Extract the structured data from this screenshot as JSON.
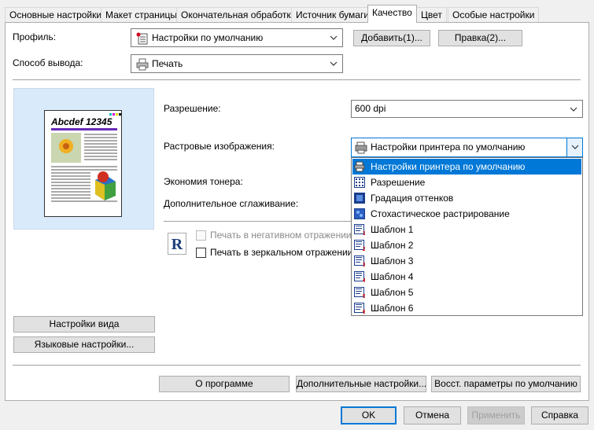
{
  "tabs": [
    "Основные настройки",
    "Макет страницы",
    "Окончательная обработка",
    "Источник бумаги",
    "Качество",
    "Цвет",
    "Особые настройки"
  ],
  "profile": {
    "label": "Профиль:",
    "value": "Настройки по умолчанию",
    "add_button": "Добавить(1)...",
    "edit_button": "Правка(2)..."
  },
  "output": {
    "label": "Способ вывода:",
    "value": "Печать"
  },
  "preview": {
    "heading": "Abcdef 12345"
  },
  "resolution": {
    "label": "Разрешение:",
    "value": "600 dpi"
  },
  "raster": {
    "label": "Растровые изображения:",
    "value": "Настройки принтера по умолчанию",
    "options": [
      "Настройки принтера по умолчанию",
      "Разрешение",
      "Градация оттенков",
      "Стохастическое растрирование",
      "Шаблон 1",
      "Шаблон 2",
      "Шаблон 3",
      "Шаблон 4",
      "Шаблон 5",
      "Шаблон 6"
    ]
  },
  "toner_label": "Экономия тонера:",
  "smoothing_label": "Дополнительное сглаживание:",
  "negative_label": "Печать в негативном отражении",
  "mirror_label": "Печать в зеркальном отражении",
  "view_settings_button": "Настройки вида",
  "language_button": "Языковые настройки...",
  "about_button": "О программе",
  "advanced_button": "Дополнительные настройки...",
  "restore_button": "Восст. параметры по умолчанию",
  "ok": "OK",
  "cancel": "Отмена",
  "apply": "Применить",
  "help": "Справка",
  "colors": {
    "accent": "#0078d7",
    "preview_bg": "#d9ebfb"
  }
}
